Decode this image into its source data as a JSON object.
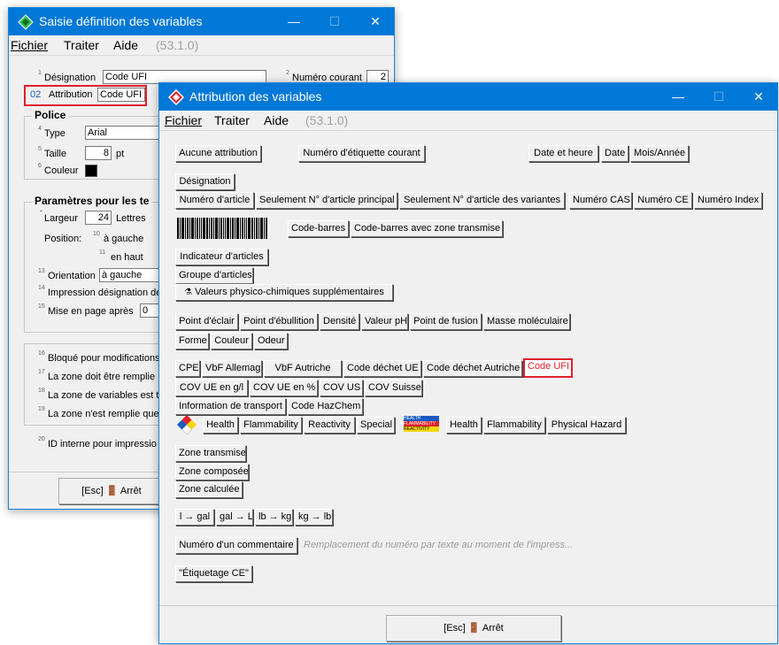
{
  "back": {
    "title": "Saisie définition des variables",
    "menu": {
      "file": "Fichier",
      "process": "Traiter",
      "help": "Aide",
      "version": "(53.1.0)"
    },
    "designation_label": "Désignation",
    "designation_value": "Code UFI",
    "numero_courant_label": "Numéro courant",
    "numero_courant_value": "2",
    "attribution_badge": "02",
    "attribution_label": "Attribution",
    "attribution_value": "Code UFI",
    "police_title": "Police",
    "type_label": "Type",
    "type_value": "Arial",
    "taille_label": "Taille",
    "taille_value": "8",
    "taille_unit": "pt",
    "couleur_label": "Couleur",
    "params_title": "Paramètres pour les te",
    "largeur_label": "Largeur",
    "largeur_value": "24",
    "largeur_unit": "Lettres",
    "position_label": "Position:",
    "gauche_label": "à gauche",
    "haut_label": "en haut",
    "orientation_label": "Orientation",
    "orientation_value": "à gauche",
    "impression_label": "Impression désignation de",
    "mise_label": "Mise en page après",
    "mise_value": "0",
    "bloque_label": "Bloqué pour modifications",
    "zone_remplie_label": "La zone doit être remplie",
    "zone_variables_label": "La zone de variables est t",
    "zone_nremplie_label": "La zone n'est remplie que",
    "id_interne_label": "ID interne pour impressio",
    "esc_button": "[Esc]",
    "arret_label": "Arrêt",
    "sups": {
      "s1": "1",
      "s2": "2",
      "s3": "3",
      "s4": "4",
      "s5": "5",
      "s6": "6",
      "s10": "10",
      "s11": "11",
      "s13": "13",
      "s14": "14",
      "s15": "15",
      "s16": "16",
      "s17": "17",
      "s18": "18",
      "s19": "19",
      "s20": "20"
    }
  },
  "front": {
    "title": "Attribution des variables",
    "menu": {
      "file": "Fichier",
      "process": "Traiter",
      "help": "Aide",
      "version": "(53.1.0)"
    },
    "row1": {
      "aucune": "Aucune attribution",
      "numero_etiquette": "Numéro d'étiquette courant",
      "date_heure": "Date et heure",
      "date": "Date",
      "mois_annee": "Mois/Année"
    },
    "designation": "Désignation",
    "row3": {
      "numero_article": "Numéro d'article",
      "seulement_principal": "Seulement N° d'article principal",
      "seulement_variantes": "Seulement N° d'article des variantes",
      "numero_cas": "Numéro CAS",
      "numero_ce": "Numéro CE",
      "numero_index": "Numéro Index"
    },
    "row4": {
      "code_barres": "Code-barres",
      "code_barres_zone": "Code-barres avec zone transmise"
    },
    "indicateur": "Indicateur d'articles",
    "groupe": "Groupe d'articles",
    "valeurs_physico": "Valeurs physico-chimiques supplémentaires",
    "row8": {
      "eclair": "Point d'éclair",
      "ebullition": "Point d'ébullition",
      "densite": "Densité",
      "ph": "Valeur pH",
      "fusion": "Point de fusion",
      "masse": "Masse moléculaire"
    },
    "row9": {
      "forme": "Forme",
      "couleur": "Couleur",
      "odeur": "Odeur"
    },
    "row10": {
      "cpe": "CPE",
      "vbf_allemagne": "VbF Allemagne",
      "vbf_autriche": "VbF Autriche",
      "dechet_ue": "Code déchet UE",
      "dechet_autriche": "Code déchet Autriche",
      "ufi": "Code UFI"
    },
    "row11": {
      "cov_ue_gl": "COV UE en g/l",
      "cov_ue_pct": "COV UE en %",
      "cov_us": "COV US",
      "cov_suisse": "COV Suisse"
    },
    "row12": {
      "transport": "Information de transport",
      "hazchem": "Code HazChem"
    },
    "row13": {
      "health1": "Health",
      "flammability1": "Flammability",
      "reactivity": "Reactivity",
      "special": "Special",
      "health2": "Health",
      "flammability2": "Flammability",
      "physical": "Physical Hazard"
    },
    "hmis_lines": {
      "l1": "HEALTH",
      "l2": "FLAMMABILITY",
      "l3": "REACTIVITY"
    },
    "zone_transmise": "Zone transmise",
    "zone_composee": "Zone composée",
    "zone_calculee": "Zone calculée",
    "conv": {
      "l_gal": "l → gal",
      "gal_l": "gal → L",
      "lb_kg": "lb → kg",
      "kg_lb": "kg → lb"
    },
    "numero_commentaire": "Numéro d'un commentaire",
    "commentaire_hint": "Remplacement du numéro par texte au moment de l'impress...",
    "etiquetage_ce": "\"Étiquetage CE\"",
    "esc_button": "[Esc]",
    "arret_label": "Arrêt"
  },
  "colors": {
    "titlebar": "#0078d7",
    "highlight": "#e0202a",
    "window_bg": "#f0f0f0"
  }
}
